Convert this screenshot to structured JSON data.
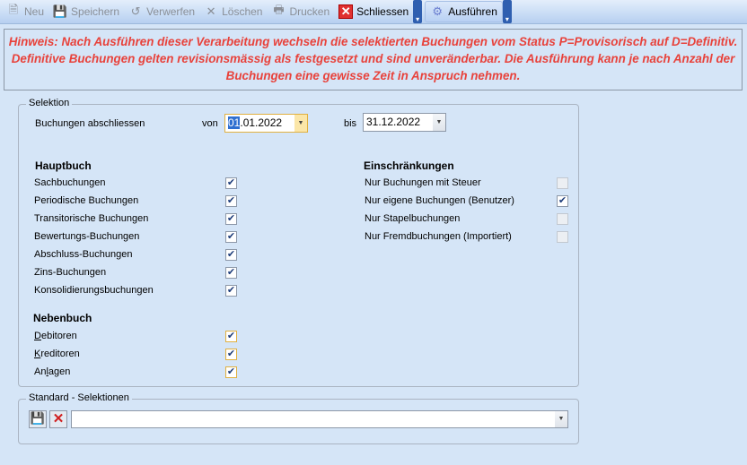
{
  "toolbar": {
    "neu": "Neu",
    "speichern": "Speichern",
    "verwerfen": "Verwerfen",
    "loeschen": "Löschen",
    "drucken": "Drucken",
    "schliessen": "Schliessen",
    "ausfuehren": "Ausführen"
  },
  "notice": "Hinweis: Nach Ausführen dieser Verarbeitung wechseln die selektierten Buchungen vom Status P=Provisorisch auf D=Definitiv. Definitive Buchungen gelten revisionsmässig als festgesetzt und sind unveränderbar. Die Ausführung kann je nach Anzahl der Buchungen eine gewisse Zeit in Anspruch nehmen.",
  "selektion": {
    "title": "Selektion",
    "label": "Buchungen abschliessen",
    "von": "von",
    "von_sel": "01",
    "von_rest": ".01.2022",
    "bis": "bis",
    "bis_value": "31.12.2022"
  },
  "hauptbuch": {
    "title": "Hauptbuch",
    "items": [
      "Sachbuchungen",
      "Periodische Buchungen",
      "Transitorische Buchungen",
      "Bewertungs-Buchungen",
      "Abschluss-Buchungen",
      "Zins-Buchungen",
      "Konsolidierungsbuchungen"
    ]
  },
  "nebenbuch": {
    "title": "Nebenbuch",
    "items": [
      [
        "",
        "D",
        "ebitoren"
      ],
      [
        "",
        "K",
        "reditoren"
      ],
      [
        "An",
        "l",
        "agen"
      ]
    ]
  },
  "einschraenkungen": {
    "title": "Einschränkungen",
    "items": [
      "Nur Buchungen mit Steuer",
      "Nur eigene Buchungen (Benutzer)",
      "Nur Stapelbuchungen",
      "Nur Fremdbuchungen (Importiert)"
    ],
    "checked": [
      false,
      true,
      false,
      false
    ]
  },
  "standard": {
    "title": "Standard - Selektionen",
    "value": ""
  }
}
